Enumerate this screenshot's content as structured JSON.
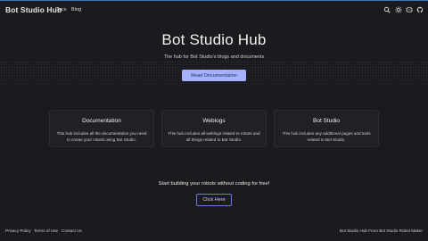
{
  "header": {
    "brand": "Bot Studio Hub",
    "nav": [
      {
        "label": "Docs"
      },
      {
        "label": "Blog"
      }
    ],
    "icons": [
      "search-icon",
      "theme-toggle-icon",
      "discord-icon",
      "github-icon"
    ]
  },
  "hero": {
    "title": "Bot Studio Hub",
    "subtitle": "The hub for Bot Studio's blogs and documents",
    "button_label": "Read Documentation"
  },
  "cards": [
    {
      "title": "Documentation",
      "description": "This hub includes all the documentation you need to create your robots using Bot Studio."
    },
    {
      "title": "Weblogs",
      "description": "This hub includes all weblogs related to robots and all things related to Bot Studio."
    },
    {
      "title": "Bot Studio",
      "description": "This hub includes any additional pages and tools related to Bot Studio."
    }
  ],
  "cta": {
    "text": "Start building your robots without coding for free!",
    "button_label": "Click Here"
  },
  "footer": {
    "links": [
      {
        "label": "Privacy Policy"
      },
      {
        "label": "Terms of Use"
      },
      {
        "label": "Contact Us"
      }
    ],
    "right_text": "Bot Studio Hub From Bot Studio Robot Maker"
  },
  "colors": {
    "background": "#1b1b1f",
    "accent": "#a8b1ff",
    "card_bg": "#202127",
    "top_border": "#3c7ab8"
  }
}
